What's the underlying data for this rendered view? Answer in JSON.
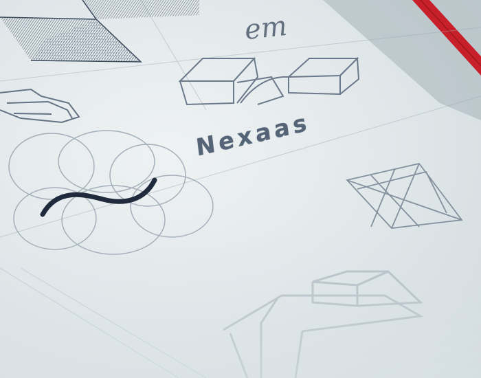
{
  "sketch": {
    "wordmark": "Nexaas",
    "monogram": "em"
  },
  "colors": {
    "paper": "#e6ecee",
    "pencil": "#5a6878",
    "ink": "#2e3b4d",
    "ribbon": "#c8202a"
  },
  "icons": [
    "tilted-square-icon",
    "cube-icon",
    "circle-grid-icon",
    "tilde-curve-icon",
    "crossed-box-icon"
  ]
}
